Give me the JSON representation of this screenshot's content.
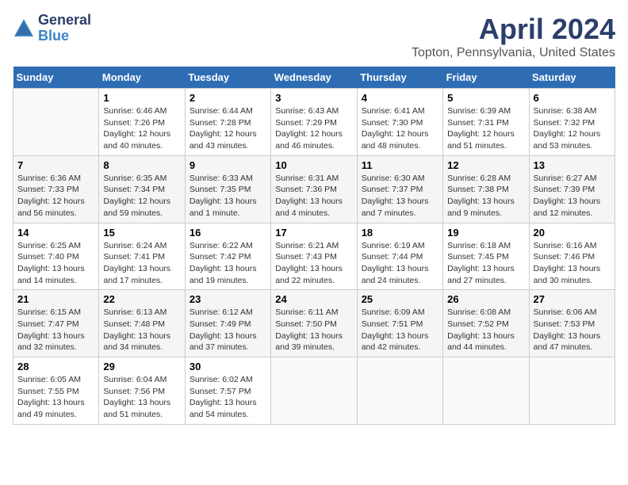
{
  "header": {
    "logo_general": "General",
    "logo_blue": "Blue",
    "title": "April 2024",
    "subtitle": "Topton, Pennsylvania, United States"
  },
  "days_of_week": [
    "Sunday",
    "Monday",
    "Tuesday",
    "Wednesday",
    "Thursday",
    "Friday",
    "Saturday"
  ],
  "weeks": [
    [
      {
        "day": "",
        "info": ""
      },
      {
        "day": "1",
        "info": "Sunrise: 6:46 AM\nSunset: 7:26 PM\nDaylight: 12 hours\nand 40 minutes."
      },
      {
        "day": "2",
        "info": "Sunrise: 6:44 AM\nSunset: 7:28 PM\nDaylight: 12 hours\nand 43 minutes."
      },
      {
        "day": "3",
        "info": "Sunrise: 6:43 AM\nSunset: 7:29 PM\nDaylight: 12 hours\nand 46 minutes."
      },
      {
        "day": "4",
        "info": "Sunrise: 6:41 AM\nSunset: 7:30 PM\nDaylight: 12 hours\nand 48 minutes."
      },
      {
        "day": "5",
        "info": "Sunrise: 6:39 AM\nSunset: 7:31 PM\nDaylight: 12 hours\nand 51 minutes."
      },
      {
        "day": "6",
        "info": "Sunrise: 6:38 AM\nSunset: 7:32 PM\nDaylight: 12 hours\nand 53 minutes."
      }
    ],
    [
      {
        "day": "7",
        "info": "Sunrise: 6:36 AM\nSunset: 7:33 PM\nDaylight: 12 hours\nand 56 minutes."
      },
      {
        "day": "8",
        "info": "Sunrise: 6:35 AM\nSunset: 7:34 PM\nDaylight: 12 hours\nand 59 minutes."
      },
      {
        "day": "9",
        "info": "Sunrise: 6:33 AM\nSunset: 7:35 PM\nDaylight: 13 hours\nand 1 minute."
      },
      {
        "day": "10",
        "info": "Sunrise: 6:31 AM\nSunset: 7:36 PM\nDaylight: 13 hours\nand 4 minutes."
      },
      {
        "day": "11",
        "info": "Sunrise: 6:30 AM\nSunset: 7:37 PM\nDaylight: 13 hours\nand 7 minutes."
      },
      {
        "day": "12",
        "info": "Sunrise: 6:28 AM\nSunset: 7:38 PM\nDaylight: 13 hours\nand 9 minutes."
      },
      {
        "day": "13",
        "info": "Sunrise: 6:27 AM\nSunset: 7:39 PM\nDaylight: 13 hours\nand 12 minutes."
      }
    ],
    [
      {
        "day": "14",
        "info": "Sunrise: 6:25 AM\nSunset: 7:40 PM\nDaylight: 13 hours\nand 14 minutes."
      },
      {
        "day": "15",
        "info": "Sunrise: 6:24 AM\nSunset: 7:41 PM\nDaylight: 13 hours\nand 17 minutes."
      },
      {
        "day": "16",
        "info": "Sunrise: 6:22 AM\nSunset: 7:42 PM\nDaylight: 13 hours\nand 19 minutes."
      },
      {
        "day": "17",
        "info": "Sunrise: 6:21 AM\nSunset: 7:43 PM\nDaylight: 13 hours\nand 22 minutes."
      },
      {
        "day": "18",
        "info": "Sunrise: 6:19 AM\nSunset: 7:44 PM\nDaylight: 13 hours\nand 24 minutes."
      },
      {
        "day": "19",
        "info": "Sunrise: 6:18 AM\nSunset: 7:45 PM\nDaylight: 13 hours\nand 27 minutes."
      },
      {
        "day": "20",
        "info": "Sunrise: 6:16 AM\nSunset: 7:46 PM\nDaylight: 13 hours\nand 30 minutes."
      }
    ],
    [
      {
        "day": "21",
        "info": "Sunrise: 6:15 AM\nSunset: 7:47 PM\nDaylight: 13 hours\nand 32 minutes."
      },
      {
        "day": "22",
        "info": "Sunrise: 6:13 AM\nSunset: 7:48 PM\nDaylight: 13 hours\nand 34 minutes."
      },
      {
        "day": "23",
        "info": "Sunrise: 6:12 AM\nSunset: 7:49 PM\nDaylight: 13 hours\nand 37 minutes."
      },
      {
        "day": "24",
        "info": "Sunrise: 6:11 AM\nSunset: 7:50 PM\nDaylight: 13 hours\nand 39 minutes."
      },
      {
        "day": "25",
        "info": "Sunrise: 6:09 AM\nSunset: 7:51 PM\nDaylight: 13 hours\nand 42 minutes."
      },
      {
        "day": "26",
        "info": "Sunrise: 6:08 AM\nSunset: 7:52 PM\nDaylight: 13 hours\nand 44 minutes."
      },
      {
        "day": "27",
        "info": "Sunrise: 6:06 AM\nSunset: 7:53 PM\nDaylight: 13 hours\nand 47 minutes."
      }
    ],
    [
      {
        "day": "28",
        "info": "Sunrise: 6:05 AM\nSunset: 7:55 PM\nDaylight: 13 hours\nand 49 minutes."
      },
      {
        "day": "29",
        "info": "Sunrise: 6:04 AM\nSunset: 7:56 PM\nDaylight: 13 hours\nand 51 minutes."
      },
      {
        "day": "30",
        "info": "Sunrise: 6:02 AM\nSunset: 7:57 PM\nDaylight: 13 hours\nand 54 minutes."
      },
      {
        "day": "",
        "info": ""
      },
      {
        "day": "",
        "info": ""
      },
      {
        "day": "",
        "info": ""
      },
      {
        "day": "",
        "info": ""
      }
    ]
  ]
}
